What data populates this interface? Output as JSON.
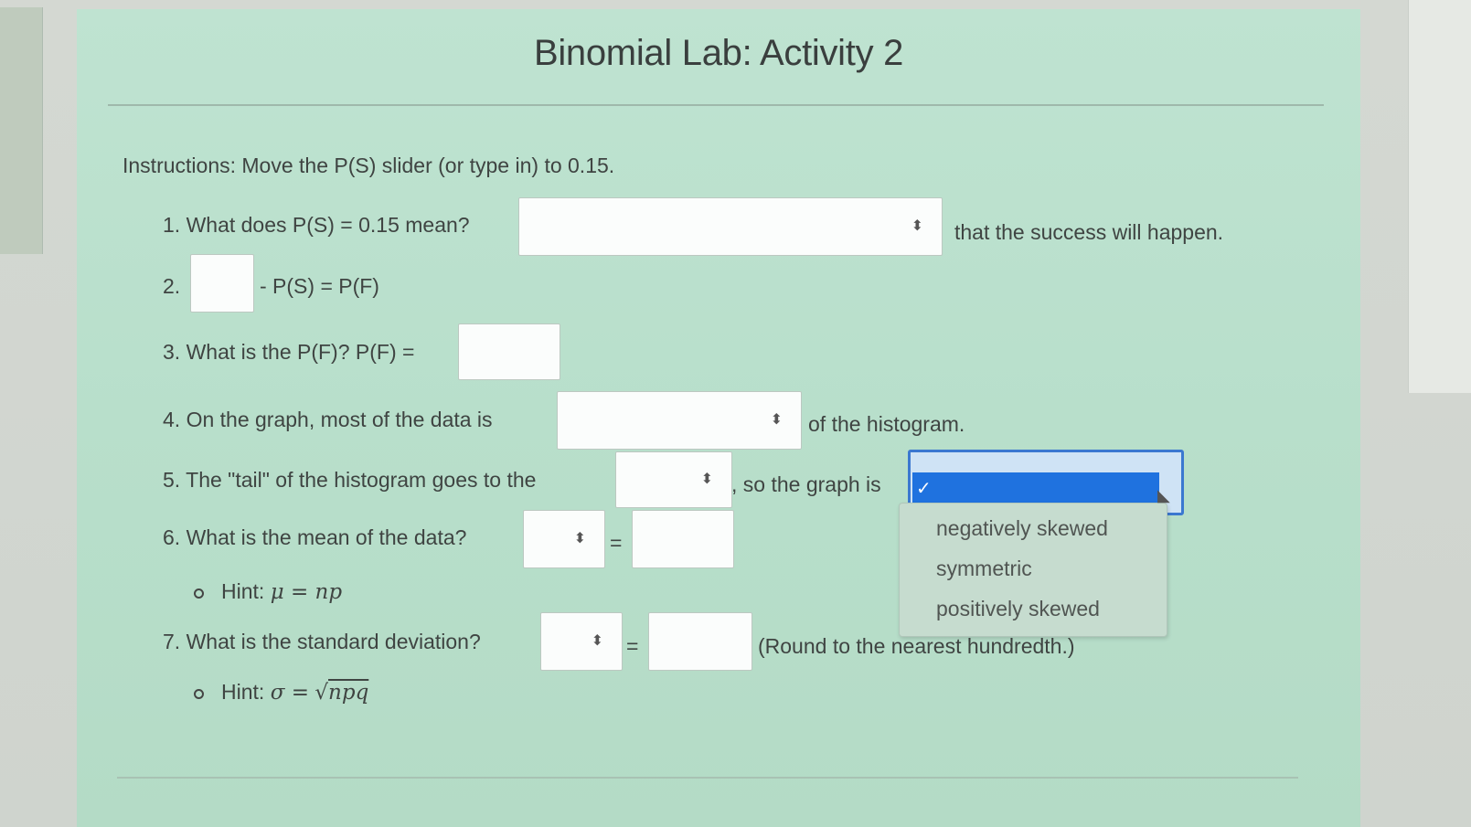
{
  "page": {
    "title": "Binomial Lab: Activity 2"
  },
  "instructions": {
    "label": "Instructions:",
    "text": "Move the P(S) slider (or type in) to 0.15."
  },
  "q1": {
    "prompt": "1. What does P(S) = 0.15 mean?",
    "select_value": "",
    "suffix": "that the success will happen."
  },
  "q2": {
    "prefix": "2.",
    "input_value": "",
    "suffix": "- P(S) = P(F)"
  },
  "q3": {
    "prompt": "3. What is the P(F)? P(F) =",
    "input_value": ""
  },
  "q4": {
    "prompt": "4. On the graph, most of the data is",
    "select_value": "",
    "suffix": "of the histogram."
  },
  "q5": {
    "prompt": "5. The \"tail\" of the histogram goes to the",
    "select_value": "",
    "mid": ", so the graph is",
    "dropdown": {
      "selected_mark": "✓",
      "options": [
        "negatively skewed",
        "symmetric",
        "positively skewed"
      ]
    }
  },
  "q6": {
    "prompt": "6. What is the mean of the data?",
    "select_value": "",
    "equals": "=",
    "input_value": "",
    "hint_label": "Hint:",
    "hint_formula": "μ = np"
  },
  "q7": {
    "prompt": "7. What is the standard deviation?",
    "select_value": "",
    "equals": "=",
    "input_value": "",
    "suffix": "(Round to the nearest hundredth.)",
    "hint_label": "Hint:",
    "hint_formula_lhs": "σ =",
    "hint_formula_sqrt": "√",
    "hint_formula_rad": "npq"
  },
  "icons": {
    "select_arrow": "⬍"
  }
}
